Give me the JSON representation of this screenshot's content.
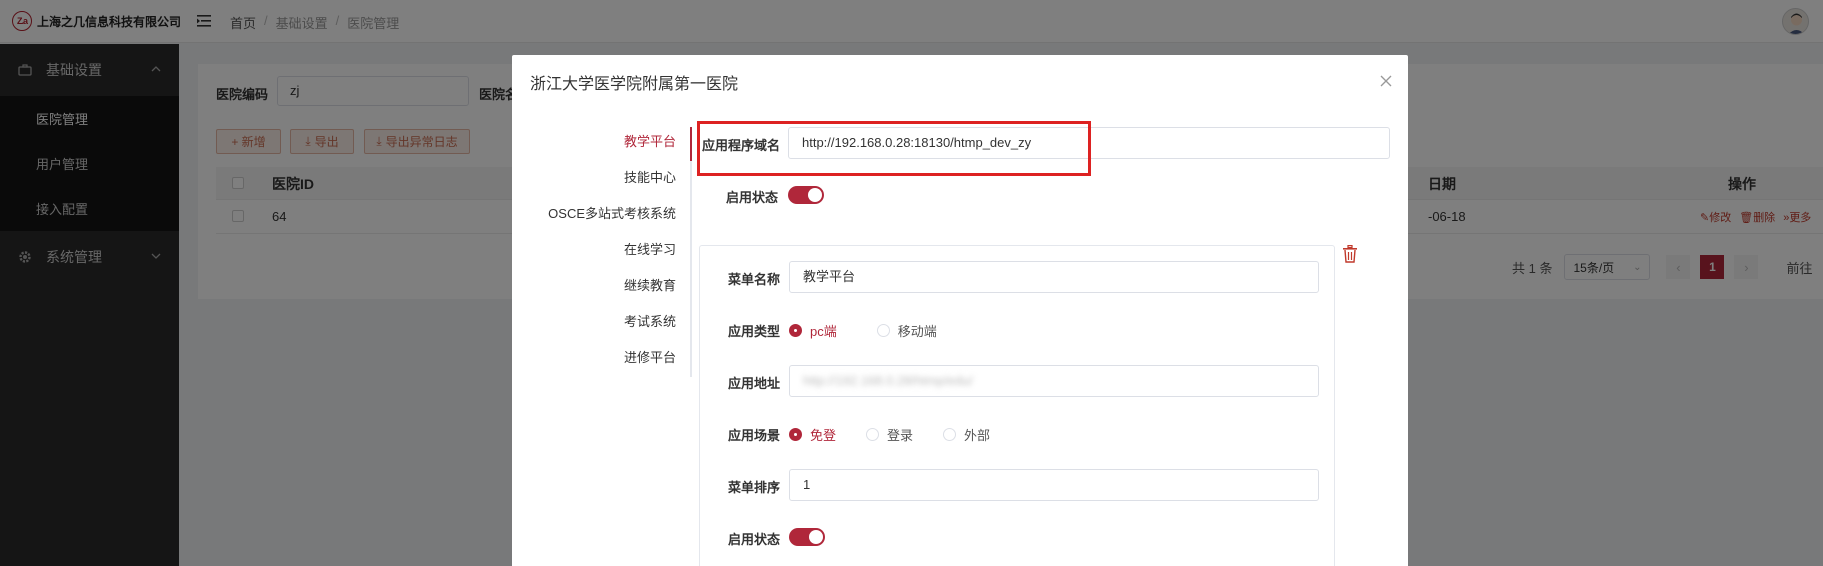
{
  "app": {
    "logo_mark": "Z.a",
    "company": "上海之几信息科技有限公司"
  },
  "breadcrumb": [
    "首页",
    "基础设置",
    "医院管理"
  ],
  "sidebar": {
    "groups": [
      {
        "label": "基础设置",
        "items": [
          "医院管理",
          "用户管理",
          "接入配置"
        ]
      },
      {
        "label": "系统管理",
        "items": []
      }
    ],
    "active_item": "医院管理"
  },
  "filters": {
    "hospital_code_label": "医院编码",
    "hospital_code_value": "zj",
    "hospital_name_label_partial": "医院名"
  },
  "toolbar": {
    "add_label": "+ 新增",
    "export_label": "导出",
    "export_log_label": "导出异常日志"
  },
  "table": {
    "headers": {
      "id": "医院ID",
      "date": "日期",
      "ops": "操作"
    },
    "rows": [
      {
        "id": "64",
        "date": "-06-18"
      }
    ],
    "row_ops": {
      "edit": "修改",
      "delete": "删除",
      "more": "更多"
    }
  },
  "pagination": {
    "total": "共 1 条",
    "page_size": "15条/页",
    "current_page": "1",
    "goto": "前往"
  },
  "dialog": {
    "title": "浙江大学医学院附属第一医院",
    "tabs": [
      "教学平台",
      "技能中心",
      "OSCE多站式考核系统",
      "在线学习",
      "继续教育",
      "考试系统",
      "进修平台"
    ],
    "active_tab": "教学平台",
    "domain_label": "应用程序域名",
    "domain_value": "http://192.168.0.28:18130/htmp_dev_zy",
    "enable_label": "启用状态",
    "enable_on": true,
    "menu": {
      "name_label": "菜单名称",
      "name_value": "教学平台",
      "type_label": "应用类型",
      "type_options": [
        "pc端",
        "移动端"
      ],
      "type_selected": "pc端",
      "url_label": "应用地址",
      "url_value": "http://192.168.0.28/htmp/edu/",
      "scene_label": "应用场景",
      "scene_options": [
        "免登",
        "登录",
        "外部"
      ],
      "scene_selected": "免登",
      "order_label": "菜单排序",
      "order_value": "1",
      "enable_label": "启用状态",
      "enable_on": true
    }
  },
  "colors": {
    "accent": "#b0273a",
    "sidebar_bg": "#2b2b2b",
    "highlight_box": "#dd2222"
  }
}
